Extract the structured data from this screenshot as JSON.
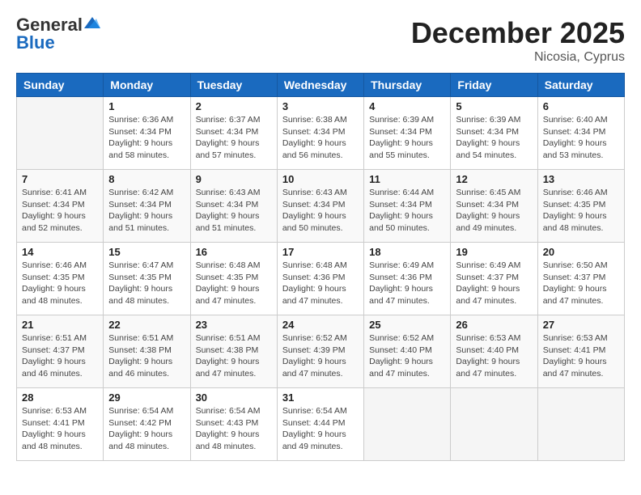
{
  "logo": {
    "general": "General",
    "blue": "Blue"
  },
  "title": "December 2025",
  "location": "Nicosia, Cyprus",
  "days_of_week": [
    "Sunday",
    "Monday",
    "Tuesday",
    "Wednesday",
    "Thursday",
    "Friday",
    "Saturday"
  ],
  "weeks": [
    [
      {
        "day": "",
        "info": ""
      },
      {
        "day": "1",
        "info": "Sunrise: 6:36 AM\nSunset: 4:34 PM\nDaylight: 9 hours\nand 58 minutes."
      },
      {
        "day": "2",
        "info": "Sunrise: 6:37 AM\nSunset: 4:34 PM\nDaylight: 9 hours\nand 57 minutes."
      },
      {
        "day": "3",
        "info": "Sunrise: 6:38 AM\nSunset: 4:34 PM\nDaylight: 9 hours\nand 56 minutes."
      },
      {
        "day": "4",
        "info": "Sunrise: 6:39 AM\nSunset: 4:34 PM\nDaylight: 9 hours\nand 55 minutes."
      },
      {
        "day": "5",
        "info": "Sunrise: 6:39 AM\nSunset: 4:34 PM\nDaylight: 9 hours\nand 54 minutes."
      },
      {
        "day": "6",
        "info": "Sunrise: 6:40 AM\nSunset: 4:34 PM\nDaylight: 9 hours\nand 53 minutes."
      }
    ],
    [
      {
        "day": "7",
        "info": "Sunrise: 6:41 AM\nSunset: 4:34 PM\nDaylight: 9 hours\nand 52 minutes."
      },
      {
        "day": "8",
        "info": "Sunrise: 6:42 AM\nSunset: 4:34 PM\nDaylight: 9 hours\nand 51 minutes."
      },
      {
        "day": "9",
        "info": "Sunrise: 6:43 AM\nSunset: 4:34 PM\nDaylight: 9 hours\nand 51 minutes."
      },
      {
        "day": "10",
        "info": "Sunrise: 6:43 AM\nSunset: 4:34 PM\nDaylight: 9 hours\nand 50 minutes."
      },
      {
        "day": "11",
        "info": "Sunrise: 6:44 AM\nSunset: 4:34 PM\nDaylight: 9 hours\nand 50 minutes."
      },
      {
        "day": "12",
        "info": "Sunrise: 6:45 AM\nSunset: 4:34 PM\nDaylight: 9 hours\nand 49 minutes."
      },
      {
        "day": "13",
        "info": "Sunrise: 6:46 AM\nSunset: 4:35 PM\nDaylight: 9 hours\nand 48 minutes."
      }
    ],
    [
      {
        "day": "14",
        "info": "Sunrise: 6:46 AM\nSunset: 4:35 PM\nDaylight: 9 hours\nand 48 minutes."
      },
      {
        "day": "15",
        "info": "Sunrise: 6:47 AM\nSunset: 4:35 PM\nDaylight: 9 hours\nand 48 minutes."
      },
      {
        "day": "16",
        "info": "Sunrise: 6:48 AM\nSunset: 4:35 PM\nDaylight: 9 hours\nand 47 minutes."
      },
      {
        "day": "17",
        "info": "Sunrise: 6:48 AM\nSunset: 4:36 PM\nDaylight: 9 hours\nand 47 minutes."
      },
      {
        "day": "18",
        "info": "Sunrise: 6:49 AM\nSunset: 4:36 PM\nDaylight: 9 hours\nand 47 minutes."
      },
      {
        "day": "19",
        "info": "Sunrise: 6:49 AM\nSunset: 4:37 PM\nDaylight: 9 hours\nand 47 minutes."
      },
      {
        "day": "20",
        "info": "Sunrise: 6:50 AM\nSunset: 4:37 PM\nDaylight: 9 hours\nand 47 minutes."
      }
    ],
    [
      {
        "day": "21",
        "info": "Sunrise: 6:51 AM\nSunset: 4:37 PM\nDaylight: 9 hours\nand 46 minutes."
      },
      {
        "day": "22",
        "info": "Sunrise: 6:51 AM\nSunset: 4:38 PM\nDaylight: 9 hours\nand 46 minutes."
      },
      {
        "day": "23",
        "info": "Sunrise: 6:51 AM\nSunset: 4:38 PM\nDaylight: 9 hours\nand 47 minutes."
      },
      {
        "day": "24",
        "info": "Sunrise: 6:52 AM\nSunset: 4:39 PM\nDaylight: 9 hours\nand 47 minutes."
      },
      {
        "day": "25",
        "info": "Sunrise: 6:52 AM\nSunset: 4:40 PM\nDaylight: 9 hours\nand 47 minutes."
      },
      {
        "day": "26",
        "info": "Sunrise: 6:53 AM\nSunset: 4:40 PM\nDaylight: 9 hours\nand 47 minutes."
      },
      {
        "day": "27",
        "info": "Sunrise: 6:53 AM\nSunset: 4:41 PM\nDaylight: 9 hours\nand 47 minutes."
      }
    ],
    [
      {
        "day": "28",
        "info": "Sunrise: 6:53 AM\nSunset: 4:41 PM\nDaylight: 9 hours\nand 48 minutes."
      },
      {
        "day": "29",
        "info": "Sunrise: 6:54 AM\nSunset: 4:42 PM\nDaylight: 9 hours\nand 48 minutes."
      },
      {
        "day": "30",
        "info": "Sunrise: 6:54 AM\nSunset: 4:43 PM\nDaylight: 9 hours\nand 48 minutes."
      },
      {
        "day": "31",
        "info": "Sunrise: 6:54 AM\nSunset: 4:44 PM\nDaylight: 9 hours\nand 49 minutes."
      },
      {
        "day": "",
        "info": ""
      },
      {
        "day": "",
        "info": ""
      },
      {
        "day": "",
        "info": ""
      }
    ]
  ]
}
